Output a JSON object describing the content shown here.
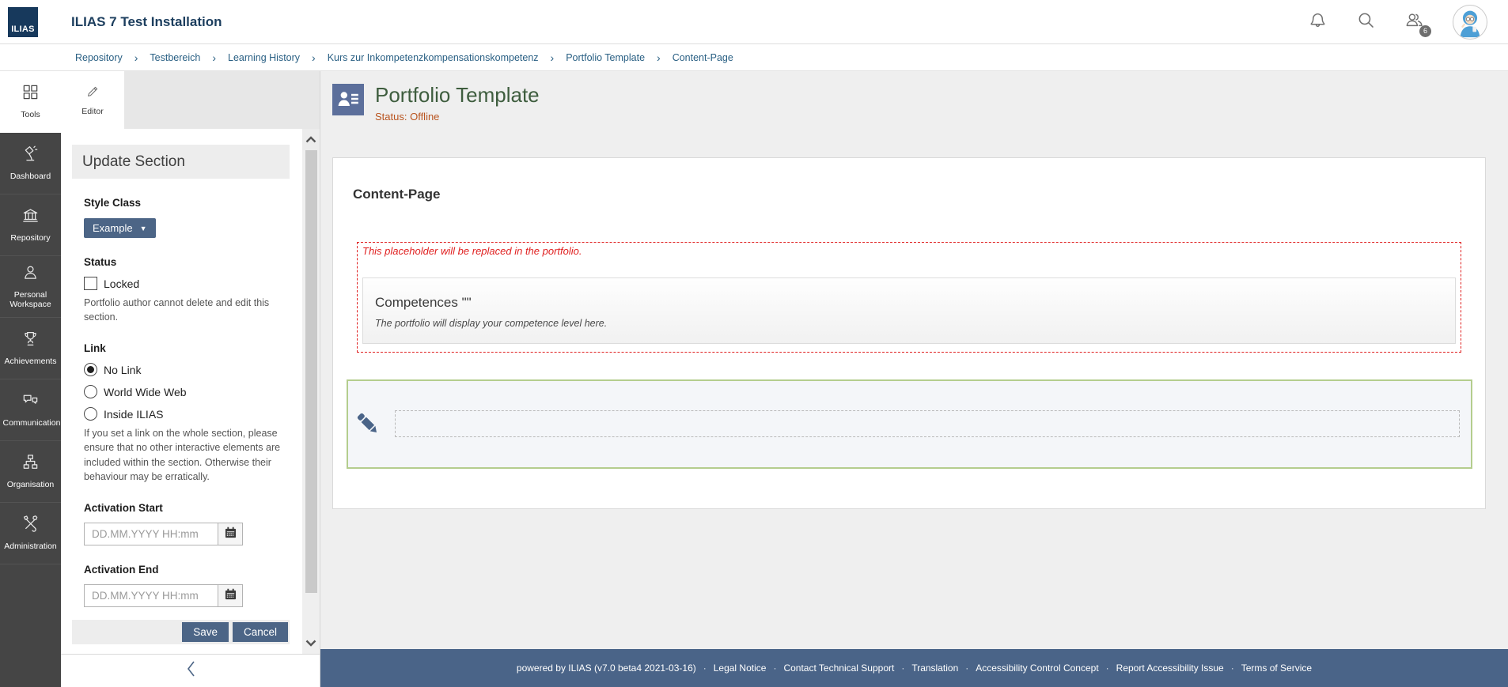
{
  "topbar": {
    "logo_text": "ILIAS",
    "title": "ILIAS 7 Test Installation",
    "awareness_count": "6"
  },
  "breadcrumb": {
    "separator": "›",
    "items": [
      "Repository",
      "Testbereich",
      "Learning History",
      "Kurs zur Inkompetenzkompensationskompetenz",
      "Portfolio Template",
      "Content-Page"
    ]
  },
  "sidebar": {
    "items": [
      {
        "label": "Tools",
        "icon": "grid-icon",
        "active": true
      },
      {
        "label": "Dashboard",
        "icon": "desk-lamp-icon",
        "active": false
      },
      {
        "label": "Repository",
        "icon": "building-icon",
        "active": false
      },
      {
        "label": "Personal Workspace",
        "icon": "person-icon",
        "active": false
      },
      {
        "label": "Achievements",
        "icon": "trophy-icon",
        "active": false
      },
      {
        "label": "Communication",
        "icon": "chat-bubbles-icon",
        "active": false
      },
      {
        "label": "Organisation",
        "icon": "orgchart-icon",
        "active": false
      },
      {
        "label": "Administration",
        "icon": "crossed-tools-icon",
        "active": false
      }
    ]
  },
  "tools_panel": {
    "editor_tab": "Editor",
    "header": "Update Section",
    "style_class_label": "Style Class",
    "style_class_button": "Example",
    "status_label": "Status",
    "locked_label": "Locked",
    "locked_help": "Portfolio author cannot delete and edit this section.",
    "link_label": "Link",
    "link_options": [
      {
        "label": "No Link",
        "selected": true
      },
      {
        "label": "World Wide Web",
        "selected": false
      },
      {
        "label": "Inside ILIAS",
        "selected": false
      }
    ],
    "link_help": "If you set a link on the whole section, please ensure that no other interactive elements are included within the section. Otherwise their behaviour may be erratically.",
    "activation_start_label": "Activation Start",
    "activation_end_label": "Activation End",
    "date_placeholder": "DD.MM.YYYY HH:mm",
    "save_label": "Save",
    "cancel_label": "Cancel"
  },
  "main": {
    "page_title": "Portfolio Template",
    "page_status": "Status: Offline",
    "section_title": "Content-Page",
    "placeholder_note": "This placeholder will be replaced in the portfolio.",
    "competences_title": "Competences \"\"",
    "competences_text": "The portfolio will display your competence level here."
  },
  "footer": {
    "powered": "powered by ILIAS (v7.0 beta4 2021-03-16)",
    "separator": "·",
    "links": [
      "Legal Notice",
      "Contact Technical Support",
      "Translation",
      "Accessibility Control Concept",
      "Report Accessibility Issue",
      "Terms of Service"
    ]
  },
  "colors": {
    "primary": "#4c6586",
    "footer_bg": "#4a6488",
    "sidebar_bg": "#454545",
    "title_green": "#3e5d3e",
    "status_orange": "#b9541f",
    "alert_red": "#e02020",
    "edit_border_green": "#b4cd8e",
    "breadcrumb_blue": "#2a6084",
    "topbar_navy": "#1c3e5e"
  }
}
